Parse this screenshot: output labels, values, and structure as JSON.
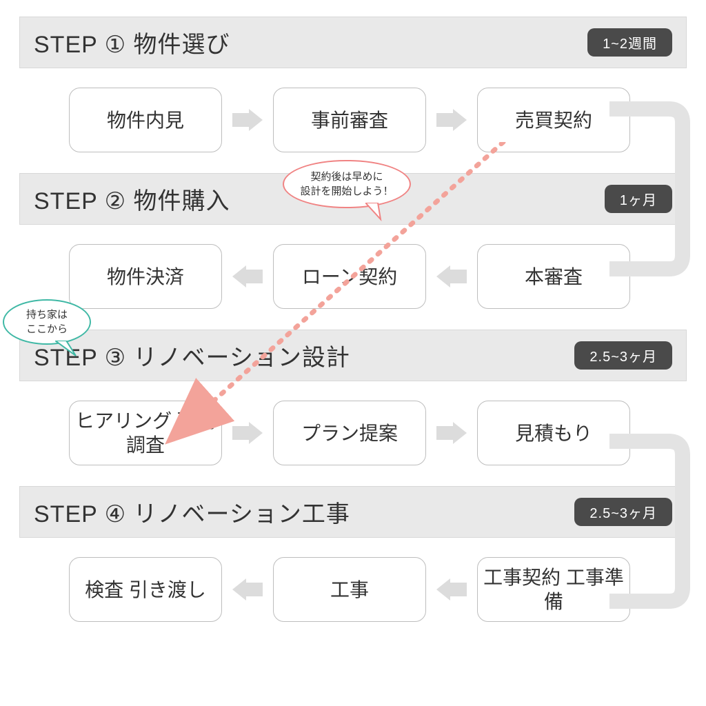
{
  "steps": [
    {
      "title": "STEP ① 物件選び",
      "duration": "1~2週間",
      "items": [
        "物件内見",
        "事前審査",
        "売買契約"
      ],
      "direction": "right"
    },
    {
      "title": "STEP ② 物件購入",
      "duration": "1ヶ月",
      "items": [
        "物件決済",
        "ローン契約",
        "本審査"
      ],
      "direction": "left"
    },
    {
      "title": "STEP ③ リノベーション設計",
      "duration": "2.5~3ヶ月",
      "items": [
        "ヒアリング\n現場調査",
        "プラン提案",
        "見積もり"
      ],
      "direction": "right"
    },
    {
      "title": "STEP ④ リノベーション工事",
      "duration": "2.5~3ヶ月",
      "items": [
        "検査\n引き渡し",
        "工事",
        "工事契約\n工事準備"
      ],
      "direction": "left"
    }
  ],
  "callouts": {
    "red": "契約後は早めに\n設計を開始しよう！",
    "teal": "持ち家は\nここから"
  }
}
